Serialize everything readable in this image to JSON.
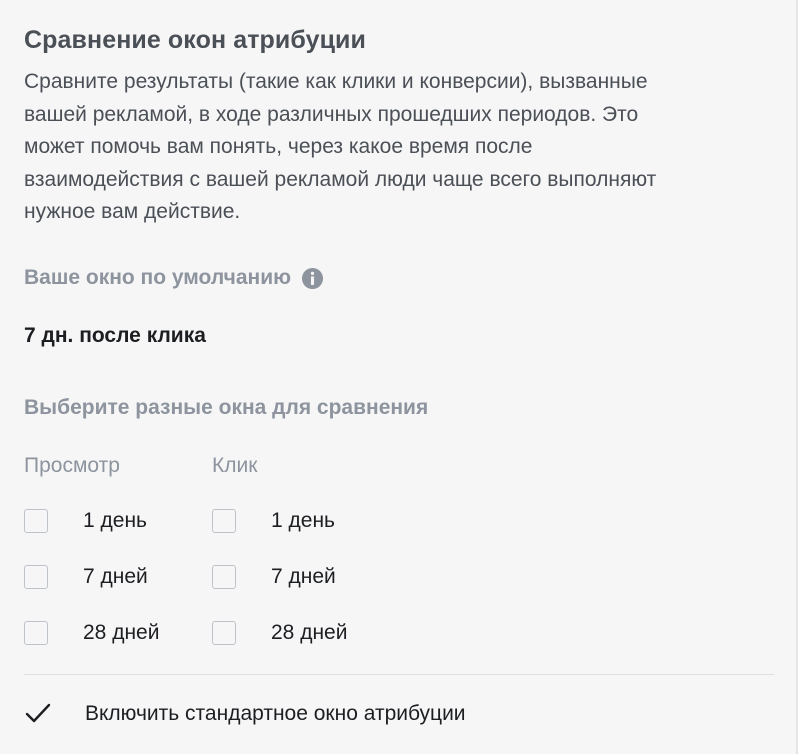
{
  "title": "Сравнение окон атрибуции",
  "description": "Сравните результаты (такие как клики и конверсии), вызванные\nвашей рекламой, в ходе различных прошедших периодов. Это\nможет помочь вам понять, через какое время после\nвзаимодействия с вашей рекламой люди чаще всего выполняют\nнужное вам действие.",
  "default_window": {
    "label": "Ваше окно по умолчанию",
    "info_icon": "info-circle-icon",
    "value": "7 дн. после клика"
  },
  "compare": {
    "label": "Выберите разные окна для сравнения",
    "view_column": {
      "header": "Просмотр",
      "options": [
        {
          "label": "1 день",
          "checked": false
        },
        {
          "label": "7 дней",
          "checked": false
        },
        {
          "label": "28 дней",
          "checked": false
        }
      ]
    },
    "click_column": {
      "header": "Клик",
      "options": [
        {
          "label": "1 день",
          "checked": false
        },
        {
          "label": "7 дней",
          "checked": false
        },
        {
          "label": "28 дней",
          "checked": false
        }
      ]
    }
  },
  "standard_window": {
    "label": "Включить стандартное окно атрибуции",
    "checked": true
  },
  "colors": {
    "panel_bg": "#f6f6f7",
    "heading": "#4b4f56",
    "muted": "#8d949e",
    "text": "#1c1e21",
    "checkbox_border": "#bec3c9"
  }
}
